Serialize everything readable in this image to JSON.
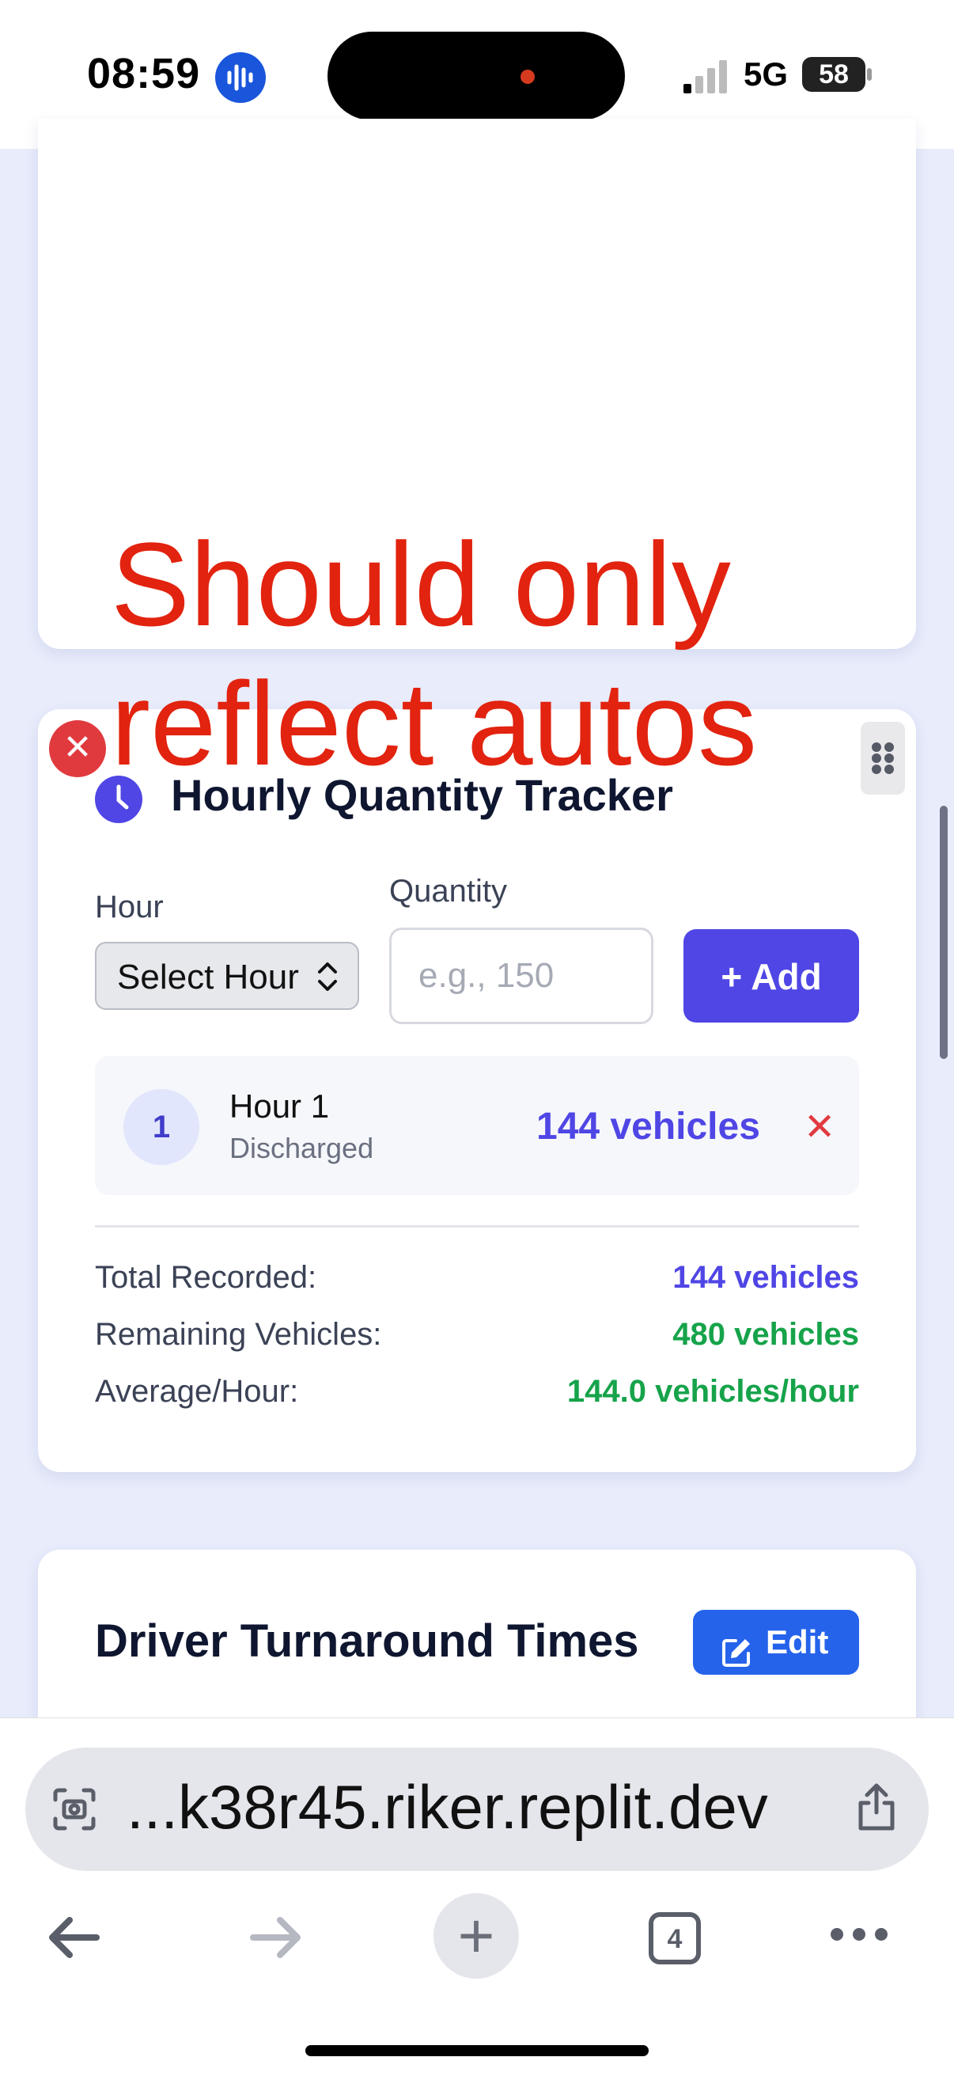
{
  "status_bar": {
    "time": "08:59",
    "network": "5G",
    "battery": "58"
  },
  "annotation": {
    "text": "Should only reflect autos"
  },
  "tracker": {
    "title": "Hourly Quantity Tracker",
    "hour_label": "Hour",
    "hour_select_value": "Select Hour",
    "quantity_label": "Quantity",
    "quantity_placeholder": "e.g., 150",
    "add_label": "+ Add",
    "entries": [
      {
        "number": "1",
        "title": "Hour 1",
        "status": "Discharged",
        "value": "144 vehicles"
      }
    ],
    "summary": [
      {
        "label": "Total Recorded:",
        "value": "144 vehicles",
        "color": "#4f46e5"
      },
      {
        "label": "Remaining Vehicles:",
        "value": "480 vehicles",
        "color": "#16a34a"
      },
      {
        "label": "Average/Hour:",
        "value": "144.0 vehicles/hour",
        "color": "#16a34a"
      }
    ]
  },
  "driver": {
    "title": "Driver Turnaround Times",
    "edit_label": "Edit"
  },
  "browser": {
    "url": "...k38r45.riker.replit.dev",
    "tab_count": "4"
  },
  "colors": {
    "accent": "#4f46e5",
    "success": "#16a34a",
    "danger": "#e03a3f",
    "edit": "#2563eb",
    "annotation": "#e2230f"
  }
}
